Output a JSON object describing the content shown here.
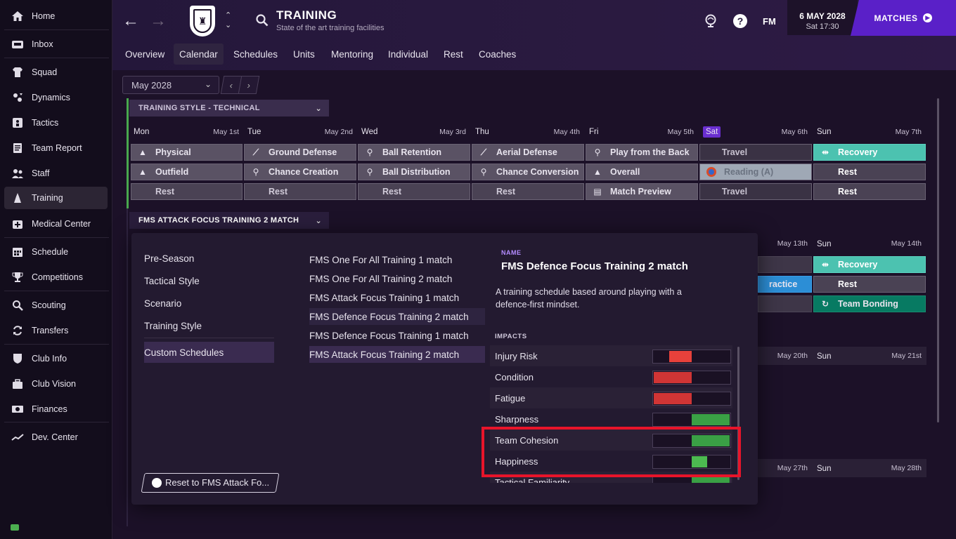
{
  "sidebar": {
    "items": [
      {
        "label": "Home",
        "icon": "home-icon"
      },
      {
        "label": "Inbox",
        "icon": "inbox-icon"
      },
      {
        "label": "Squad",
        "icon": "shirt-icon"
      },
      {
        "label": "Dynamics",
        "icon": "dynamics-icon"
      },
      {
        "label": "Tactics",
        "icon": "tactics-icon"
      },
      {
        "label": "Team Report",
        "icon": "report-icon"
      },
      {
        "label": "Staff",
        "icon": "staff-icon"
      },
      {
        "label": "Training",
        "icon": "training-icon"
      },
      {
        "label": "Medical Center",
        "icon": "medical-icon"
      },
      {
        "label": "Schedule",
        "icon": "calendar-icon"
      },
      {
        "label": "Competitions",
        "icon": "trophy-icon"
      },
      {
        "label": "Scouting",
        "icon": "scouting-icon"
      },
      {
        "label": "Transfers",
        "icon": "transfers-icon"
      },
      {
        "label": "Club Info",
        "icon": "shield-icon"
      },
      {
        "label": "Club Vision",
        "icon": "briefcase-icon"
      },
      {
        "label": "Finances",
        "icon": "finances-icon"
      },
      {
        "label": "Dev. Center",
        "icon": "dev-center-icon"
      }
    ],
    "active": "Training"
  },
  "header": {
    "title": "TRAINING",
    "subtitle": "State of the art training facilities",
    "fm_label": "FM",
    "date": "6 MAY 2028",
    "day_time": "Sat 17:30",
    "matches_label": "MATCHES"
  },
  "tabs": [
    "Overview",
    "Calendar",
    "Schedules",
    "Units",
    "Mentoring",
    "Individual",
    "Rest",
    "Coaches"
  ],
  "active_tab": "Calendar",
  "calendar": {
    "month": "May 2028",
    "style_header": "TRAINING STYLE - TECHNICAL",
    "schedule_header": "FMS ATTACK FOCUS TRAINING 2 MATCH",
    "days": [
      {
        "name": "Mon",
        "date": "May 1st"
      },
      {
        "name": "Tue",
        "date": "May 2nd"
      },
      {
        "name": "Wed",
        "date": "May 3rd"
      },
      {
        "name": "Thu",
        "date": "May 4th"
      },
      {
        "name": "Fri",
        "date": "May 5th"
      },
      {
        "name": "Sat",
        "date": "May 6th"
      },
      {
        "name": "Sun",
        "date": "May 7th"
      }
    ],
    "week1": [
      [
        "Physical",
        "Ground Defense",
        "Ball Retention",
        "Aerial Defense",
        "Play from the Back",
        "Travel",
        "Recovery"
      ],
      [
        "Outfield",
        "Chance Creation",
        "Ball Distribution",
        "Chance Conversion",
        "Overall",
        "Reading (A)",
        "Rest"
      ],
      [
        "Rest",
        "Rest",
        "Rest",
        "Rest",
        "Match Preview",
        "Travel",
        "Rest"
      ]
    ],
    "week2": {
      "sat_date": "May 13th",
      "sun": "Sun",
      "sun_date": "May 14th",
      "sat_sessions": [
        "",
        "ractice",
        ""
      ],
      "sun_sessions": [
        "Recovery",
        "Rest",
        "Team Bonding"
      ]
    },
    "week3": {
      "sat_date": "May 20th",
      "sun": "Sun",
      "sun_date": "May 21st"
    },
    "week4": {
      "sat_date": "May 27th",
      "sun": "Sun",
      "sun_date": "May 28th"
    }
  },
  "popup": {
    "categories": [
      "Pre-Season",
      "Tactical Style",
      "Scenario",
      "Training Style",
      "Custom Schedules"
    ],
    "active_category": "Custom Schedules",
    "schedules": [
      "FMS One For All Training 1 match",
      "FMS One For All Training 2 match",
      "FMS Attack Focus Training 1 match",
      "FMS Defence Focus Training 2 match",
      "FMS Defence Focus Training 1 match",
      "FMS Attack Focus Training 2 match"
    ],
    "name_label": "NAME",
    "name_value": "FMS Defence Focus Training 2 match",
    "description": "A training schedule based around playing with a defence-first mindset.",
    "impacts_label": "IMPACTS",
    "impacts": [
      {
        "label": "Injury Risk",
        "color": "#e8413b",
        "from": 0.2,
        "to": 0.5
      },
      {
        "label": "Condition",
        "color": "#d03535",
        "from": 0.0,
        "to": 0.5
      },
      {
        "label": "Fatigue",
        "color": "#d03535",
        "from": 0.0,
        "to": 0.5
      },
      {
        "label": "Sharpness",
        "color": "#3aa045",
        "from": 0.5,
        "to": 1.0
      },
      {
        "label": "Team Cohesion",
        "color": "#3aa045",
        "from": 0.5,
        "to": 1.0
      },
      {
        "label": "Happiness",
        "color": "#4cba50",
        "from": 0.5,
        "to": 0.7
      },
      {
        "label": "Tactical Familiarity",
        "color": "#3aa045",
        "from": 0.5,
        "to": 1.0
      }
    ],
    "reset_label": "Reset to FMS Attack Fo..."
  },
  "colors": {
    "accent": "#5a20c8",
    "highlight": "#e8142a"
  }
}
